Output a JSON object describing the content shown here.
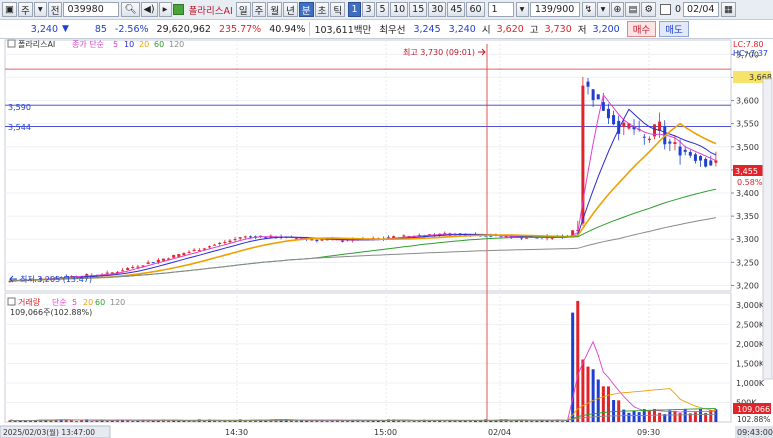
{
  "toolbar": {
    "type_toggle": "주",
    "market_toggle": "전",
    "code": "039980",
    "stock_name": "폴라리스AI",
    "periods": [
      "일",
      "주",
      "월",
      "년",
      "분",
      "초",
      "틱"
    ],
    "selected_period": "분",
    "intervals": [
      "1",
      "3",
      "5",
      "10",
      "15",
      "30",
      "45",
      "60"
    ],
    "selected_interval": "1",
    "interval_value": "1",
    "count": "139/900",
    "checkbox_value": "0",
    "date_value": "02/04"
  },
  "quote": {
    "price": "3,240",
    "price_arrow": "▼",
    "change": "85",
    "change_pct": "-2.56%",
    "volume": "29,620,962",
    "volume_ratio": "235.77%",
    "turnover": "40.94%",
    "trade_value": "103,611백만",
    "highlight_label": "최우선",
    "best_ask": "3,245",
    "best_bid": "3,240",
    "open_label": "시",
    "open": "3,620",
    "high_label": "고",
    "high": "3,730",
    "low_label": "저",
    "low": "3,200",
    "buy_button": "매수",
    "sell_button": "매도"
  },
  "price_panel": {
    "legend_name": "폴라리스AI",
    "ma_label": "종가 단순",
    "ma_periods": [
      "5",
      "10",
      "20",
      "60",
      "120"
    ],
    "lc": "LC:7.80",
    "hc": "HC:-7.37",
    "high_annotation": "최고 3,730 (09:01)",
    "low_annotation": "최저 3,205 (13:47)",
    "left_line_labels": [
      "3,590",
      "3,544"
    ],
    "right_box_top": "3,668",
    "right_box_price": "3,455",
    "right_box_pct": "0.58%"
  },
  "volume_panel": {
    "legend_name": "거래량",
    "ma_label": "단순",
    "ma_periods": [
      "5",
      "20",
      "60",
      "120"
    ],
    "current": "109,066주(102.88%)",
    "right_box_value": "109,066",
    "right_box_pct": "102.88%"
  },
  "axis": {
    "price_ticks": [
      "3,700",
      "3,650",
      "3,600",
      "3,550",
      "3,500",
      "3,450",
      "3,400",
      "3,350",
      "3,300",
      "3,250",
      "3,200"
    ],
    "volume_ticks": [
      "3,000K",
      "2,500K",
      "2,000K",
      "1,500K",
      "1,000K",
      "500K"
    ],
    "time_ticks": [
      "14:30",
      "15:00",
      "02/04",
      "09:30",
      "09:43:00"
    ],
    "cursor_time": "2025/02/03(월) 13:47:00"
  },
  "colors": {
    "up": "#e0242a",
    "down": "#1f3fd0",
    "ma5": "#e040d0",
    "ma10": "#2b2bd0",
    "ma20": "#f0a000",
    "ma60": "#2e9e2e",
    "ma120": "#8a8a8a"
  }
}
